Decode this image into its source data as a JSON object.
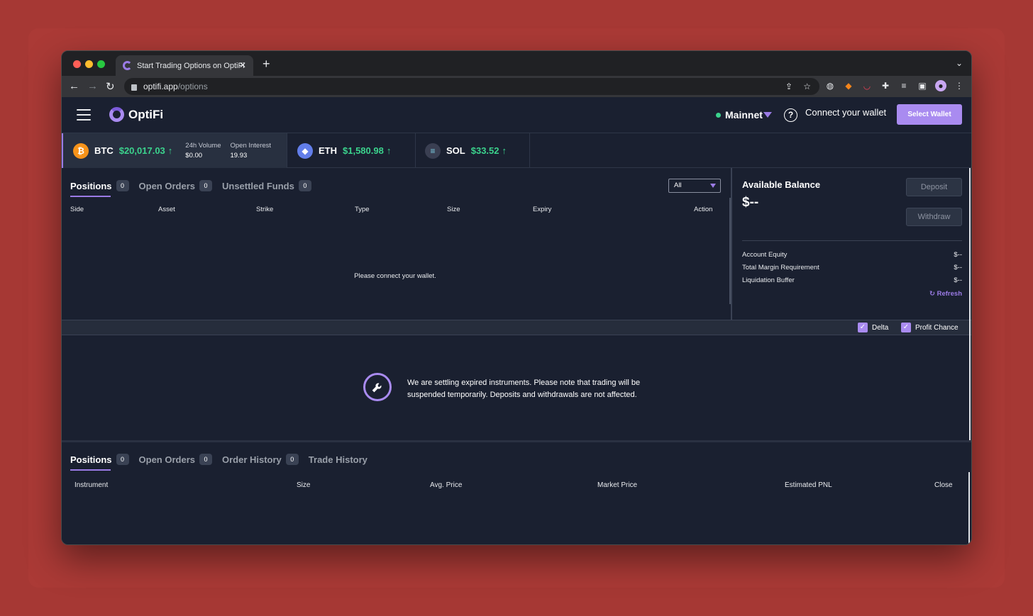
{
  "browser": {
    "tab_title": "Start Trading Options on OptiFi",
    "tab_close": "✕",
    "new_tab": "+",
    "url_host": "optifi.app",
    "url_path": "/options"
  },
  "header": {
    "logo_text": "OptiFi",
    "network": "Mainnet",
    "help": "?",
    "connect_text": "Connect your wallet",
    "select_wallet": "Select Wallet"
  },
  "tickers": [
    {
      "symbol": "BTC",
      "price": "$20,017.03",
      "coin_color": "#f7931a",
      "volume_label": "24h Volume",
      "volume": "$0.00",
      "oi_label": "Open Interest",
      "oi": "19.93"
    },
    {
      "symbol": "ETH",
      "price": "$1,580.98",
      "coin_color": "#627eea"
    },
    {
      "symbol": "SOL",
      "price": "$33.52",
      "coin_color": "#3a3f52"
    }
  ],
  "upper_tabs": [
    {
      "label": "Positions",
      "count": "0"
    },
    {
      "label": "Open Orders",
      "count": "0"
    },
    {
      "label": "Unsettled Funds",
      "count": "0"
    }
  ],
  "filter": {
    "selected": "All"
  },
  "upper_columns": [
    "Side",
    "Asset",
    "Strike",
    "Type",
    "Size",
    "Expiry",
    "Action"
  ],
  "empty_message": "Please connect your wallet.",
  "balance": {
    "title": "Available Balance",
    "amount": "$--",
    "deposit": "Deposit",
    "withdraw": "Withdraw",
    "rows": [
      {
        "label": "Account Equity",
        "value": "$--"
      },
      {
        "label": "Total Margin Requirement",
        "value": "$--"
      },
      {
        "label": "Liquidation Buffer",
        "value": "$--"
      }
    ],
    "refresh": "Refresh"
  },
  "checks": [
    {
      "label": "Delta",
      "checked": true
    },
    {
      "label": "Profit Chance",
      "checked": true
    }
  ],
  "notice": {
    "line1": "We are settling expired instruments. Please note that trading will be",
    "line2": "suspended temporarily. Deposits and withdrawals are not affected."
  },
  "lower_tabs": [
    {
      "label": "Positions",
      "count": "0"
    },
    {
      "label": "Open Orders",
      "count": "0"
    },
    {
      "label": "Order History",
      "count": "0"
    },
    {
      "label": "Trade History"
    }
  ],
  "lower_columns": [
    "Instrument",
    "Size",
    "Avg. Price",
    "Market Price",
    "Estimated PNL",
    "Close"
  ],
  "colors": {
    "accent": "#a98bf0",
    "positive": "#3bd38d",
    "background": "#1a2030"
  }
}
